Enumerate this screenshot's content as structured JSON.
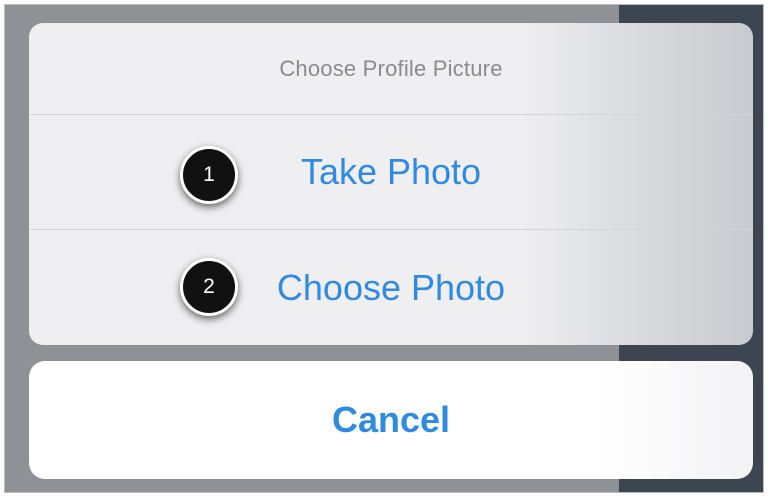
{
  "action_sheet": {
    "title": "Choose Profile Picture",
    "options": [
      {
        "label": "Take Photo",
        "callout": "1"
      },
      {
        "label": "Choose Photo",
        "callout": "2"
      }
    ],
    "cancel_label": "Cancel"
  },
  "colors": {
    "accent": "#2f8ae0",
    "title_text": "#8a8a8f",
    "callout_bg": "#111111"
  }
}
